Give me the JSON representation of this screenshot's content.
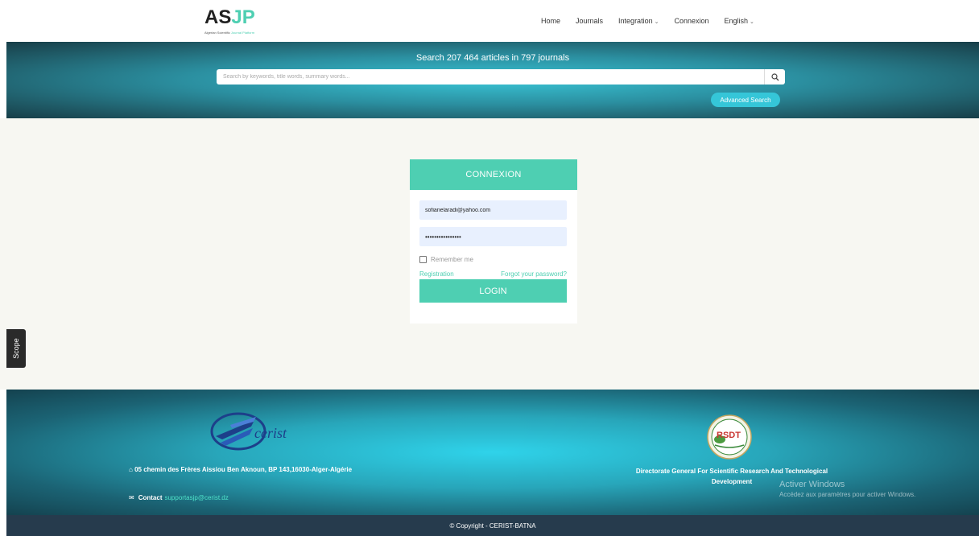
{
  "header": {
    "logo": {
      "part1": "AS",
      "part2": "JP",
      "tagline_prefix": "Algerian Scientific",
      "tagline_highlight": "Journal Platform"
    },
    "nav": {
      "home": "Home",
      "journals": "Journals",
      "integration": "Integration",
      "connexion": "Connexion",
      "language": "English"
    }
  },
  "search": {
    "title": "Search 207 464 articles in 797 journals",
    "placeholder": "Search by keywords, title words, summary words...",
    "advanced_label": "Advanced Search"
  },
  "login": {
    "title": "CONNEXION",
    "email_value": "sofianelaradi@yahoo.com",
    "password_value": "••••••••••••••••",
    "remember_label": "Remember me",
    "registration_link": "Registration",
    "forgot_link": "Forgot your password?",
    "login_button": "LOGIN"
  },
  "scope_tab": "Scope",
  "footer": {
    "cerist_logo_text": "cerist",
    "address": "05 chemin des Frères Aissiou Ben Aknoun, BP 143,16030-Alger-Algérie",
    "contact_label": "Contact",
    "contact_email": "supportasjp@cerist.dz",
    "dgrsdt_logo_text": "RSDT",
    "dgrsdt_name": "Directorate General For Scientific Research And Technological Development",
    "watermark_title": "Activer Windows",
    "watermark_sub": "Accédez aux paramètres pour activer Windows.",
    "copyright": "© Copyright - CERIST-BATNA"
  },
  "colors": {
    "accent": "#4ecfb2",
    "banner": "#2b8fa0",
    "footer_bottom": "#263b4d"
  }
}
